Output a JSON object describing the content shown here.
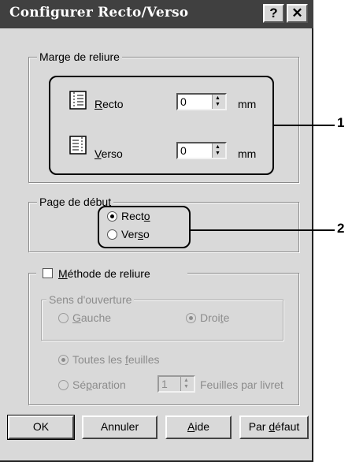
{
  "titlebar": {
    "title": "Configurer Recto/Verso",
    "help_glyph": "?",
    "close_glyph": "✕"
  },
  "margin_group": {
    "legend": "Marge de reliure",
    "recto": {
      "label_prefix": "",
      "label_mnemonic": "R",
      "label_rest": "ecto",
      "value": "0",
      "unit": "mm"
    },
    "verso": {
      "label_prefix": "",
      "label_mnemonic": "V",
      "label_rest": "erso",
      "value": "0",
      "unit": "mm"
    }
  },
  "start_page_group": {
    "legend": "Page de début",
    "options": [
      {
        "label_prefix": "Rect",
        "label_mnemonic": "o",
        "label_rest": "",
        "selected": true
      },
      {
        "label_prefix": "Ver",
        "label_mnemonic": "s",
        "label_rest": "o",
        "selected": false
      }
    ]
  },
  "binding_method": {
    "checkbox_label_mnemonic": "M",
    "checkbox_label_rest": "éthode de reliure",
    "checked": false,
    "opening_legend": "Sens d'ouverture",
    "left": {
      "label_prefix": "",
      "label_mnemonic": "G",
      "label_rest": "auche",
      "selected": false
    },
    "right": {
      "label_prefix": "Droi",
      "label_mnemonic": "t",
      "label_rest": "e",
      "selected": true
    },
    "all_sheets": {
      "label_prefix": "Toutes les ",
      "label_mnemonic": "f",
      "label_rest": "euilles",
      "selected": true
    },
    "separation": {
      "label_prefix": "Sé",
      "label_mnemonic": "p",
      "label_rest": "aration",
      "selected": false,
      "value": "1",
      "suffix": "Feuilles par livret"
    }
  },
  "buttons": {
    "ok": "OK",
    "cancel": "Annuler",
    "help_mnemonic": "A",
    "help_rest": "ide",
    "default_prefix": "Par ",
    "default_mnemonic": "d",
    "default_rest": "éfaut"
  },
  "callouts": {
    "one": "1",
    "two": "2"
  }
}
